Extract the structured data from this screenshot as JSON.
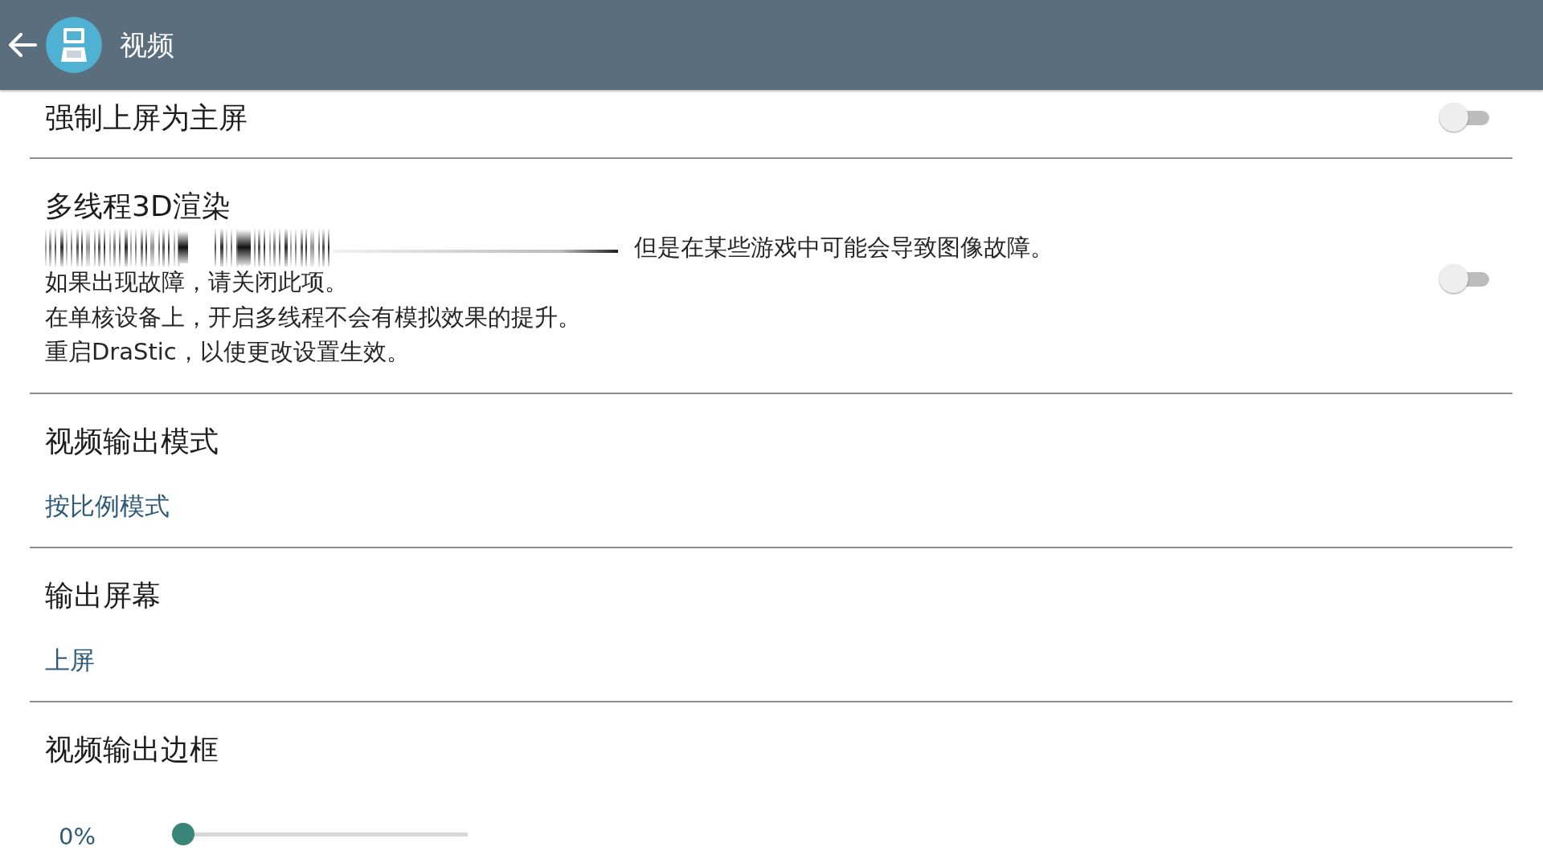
{
  "app_bar": {
    "title": "视频"
  },
  "settings": [
    {
      "kind": "switch",
      "title": "强制上屏为主屏",
      "on": false
    },
    {
      "kind": "switch",
      "title": "多线程3D渲染",
      "summary": [
        {
          "text": "但是在某些游戏中可能会导致图像故障。",
          "obscured": true
        },
        {
          "text": "如果出现故障，请关闭此项。",
          "obscured": false
        },
        {
          "text": "在单核设备上，开启多线程不会有模拟效果的提升。",
          "obscured": false
        },
        {
          "text": "重启DraStic，以使更改设置生效。",
          "obscured": false
        }
      ],
      "on": false
    },
    {
      "kind": "choice",
      "title": "视频输出模式",
      "value": "按比例模式"
    },
    {
      "kind": "choice",
      "title": "输出屏幕",
      "value": "上屏"
    },
    {
      "kind": "slider",
      "title": "视频输出边框",
      "reading": "0%",
      "level": 0
    }
  ]
}
